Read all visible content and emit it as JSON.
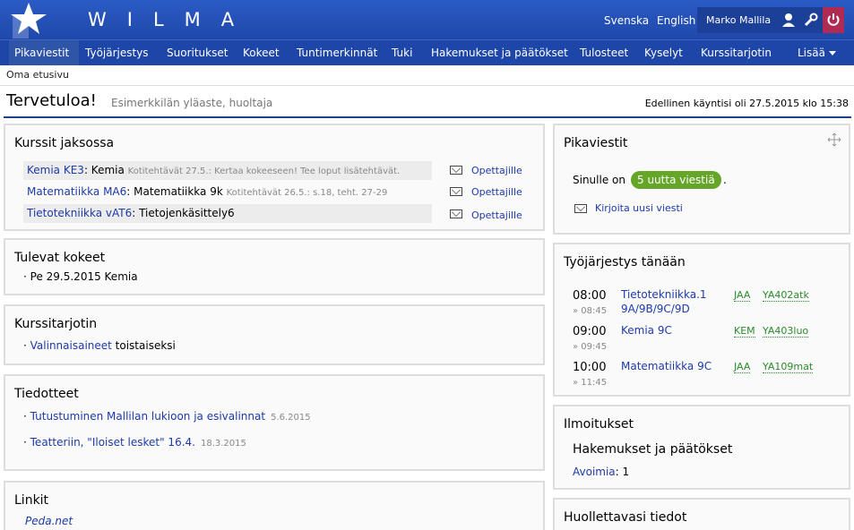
{
  "header": {
    "app_name": "WILMA",
    "lang_sv": "Svenska",
    "lang_en": "English",
    "user": "Marko Mallila"
  },
  "nav": [
    "Pikaviestit",
    "Työjärjestys",
    "Suoritukset",
    "Kokeet",
    "Tuntimerkinnät",
    "Tuki",
    "Hakemukset ja päätökset",
    "Tulosteet",
    "Kyselyt",
    "Kurssitarjotin",
    "Lisää"
  ],
  "breadcrumb": "Oma etusivu",
  "page": {
    "title": "Tervetuloa!",
    "subtitle": "Esimerkkilän yläaste, huoltaja",
    "last_visit": "Edellinen käyntisi oli 27.5.2015 klo 15:38"
  },
  "kurssit": {
    "title": "Kurssit jaksossa",
    "rows": [
      {
        "code": "Kemia KE3",
        "name": ": Kemia",
        "note": "Kotitehtävät 27.5.: Kertaa kokeeseen! Tee loput lisätehtävät.",
        "link": "Opettajille"
      },
      {
        "code": "Matematiikka MA6",
        "name": ": Matematiikka 9k",
        "note": "Kotitehtävät 26.5.: s.18, teht. 27-29",
        "link": "Opettajille"
      },
      {
        "code": "Tietotekniikka vAT6",
        "name": ": Tietojenkäsittely6",
        "note": "",
        "link": "Opettajille"
      }
    ]
  },
  "kokeet": {
    "title": "Tulevat kokeet",
    "item": "Pe 29.5.2015 Kemia"
  },
  "tarjotin": {
    "title": "Kurssitarjotin",
    "link": "Valinnaisaineet",
    "rest": " toistaiseksi"
  },
  "tiedotteet": {
    "title": "Tiedotteet",
    "items": [
      {
        "text": "Tutustuminen Mallilan lukioon ja esivalinnat",
        "date": "5.6.2015"
      },
      {
        "text": "Teatteriin, \"Iloiset lesket\" 16.4.",
        "date": "18.3.2015"
      }
    ]
  },
  "linkit": {
    "title": "Linkit",
    "item": "Peda.net"
  },
  "pikaviestit": {
    "title": "Pikaviestit",
    "prefix": "Sinulle on",
    "badge": "5 uutta viestiä",
    "suffix": ".",
    "write": "Kirjoita uusi viesti"
  },
  "tyojarjestys": {
    "title": "Työjärjestys tänään",
    "lessons": [
      {
        "start": "08:00",
        "end": "» 08:45",
        "subject": "Tietotekniikka.1",
        "groups": "9A/9B/9C/9D",
        "teacher": "JAA",
        "room": "YA402atk"
      },
      {
        "start": "09:00",
        "end": "» 09:45",
        "subject": "Kemia 9C",
        "groups": "",
        "teacher": "KEM",
        "room": "YA403luo"
      },
      {
        "start": "10:00",
        "end": "» 11:45",
        "subject": "Matematiikka 9C",
        "groups": "",
        "teacher": "JAA",
        "room": "YA109mat"
      }
    ]
  },
  "ilmoitukset": {
    "title": "Ilmoitukset",
    "subtitle": "Hakemukset ja päätökset",
    "link": "Avoimia",
    "count": ": 1"
  },
  "huollettava": {
    "title": "Huollettavasi tiedot"
  }
}
